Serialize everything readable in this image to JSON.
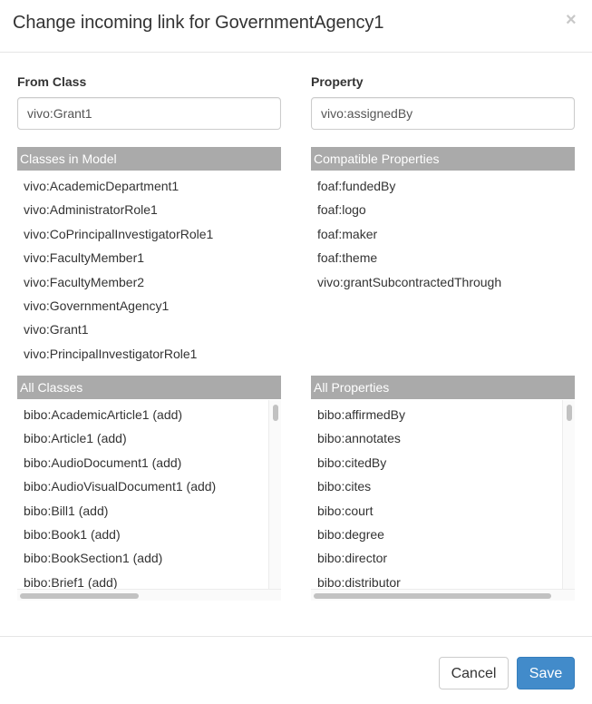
{
  "dialog": {
    "title": "Change incoming link for GovernmentAgency1",
    "close_glyph": "×"
  },
  "from_class": {
    "label": "From Class",
    "value": "vivo:Grant1"
  },
  "property": {
    "label": "Property",
    "value": "vivo:assignedBy"
  },
  "classes_in_model": {
    "header": "Classes in Model",
    "items": [
      "vivo:AcademicDepartment1",
      "vivo:AdministratorRole1",
      "vivo:CoPrincipalInvestigatorRole1",
      "vivo:FacultyMember1",
      "vivo:FacultyMember2",
      "vivo:GovernmentAgency1",
      "vivo:Grant1",
      "vivo:PrincipalInvestigatorRole1"
    ]
  },
  "compatible_properties": {
    "header": "Compatible Properties",
    "items": [
      "foaf:fundedBy",
      "foaf:logo",
      "foaf:maker",
      "foaf:theme",
      "vivo:grantSubcontractedThrough"
    ]
  },
  "all_classes": {
    "header": "All Classes",
    "items": [
      "bibo:AcademicArticle1 (add)",
      "bibo:Article1 (add)",
      "bibo:AudioDocument1 (add)",
      "bibo:AudioVisualDocument1 (add)",
      "bibo:Bill1 (add)",
      "bibo:Book1 (add)",
      "bibo:BookSection1 (add)",
      "bibo:Brief1 (add)"
    ],
    "hscroll_fraction": 0.46
  },
  "all_properties": {
    "header": "All Properties",
    "items": [
      "bibo:affirmedBy",
      "bibo:annotates",
      "bibo:citedBy",
      "bibo:cites",
      "bibo:court",
      "bibo:degree",
      "bibo:director",
      "bibo:distributor"
    ],
    "hscroll_fraction": 0.92
  },
  "footer": {
    "cancel_label": "Cancel",
    "save_label": "Save"
  },
  "colors": {
    "section_header_bg": "#aaaaaa",
    "primary_button": "#428bca"
  }
}
